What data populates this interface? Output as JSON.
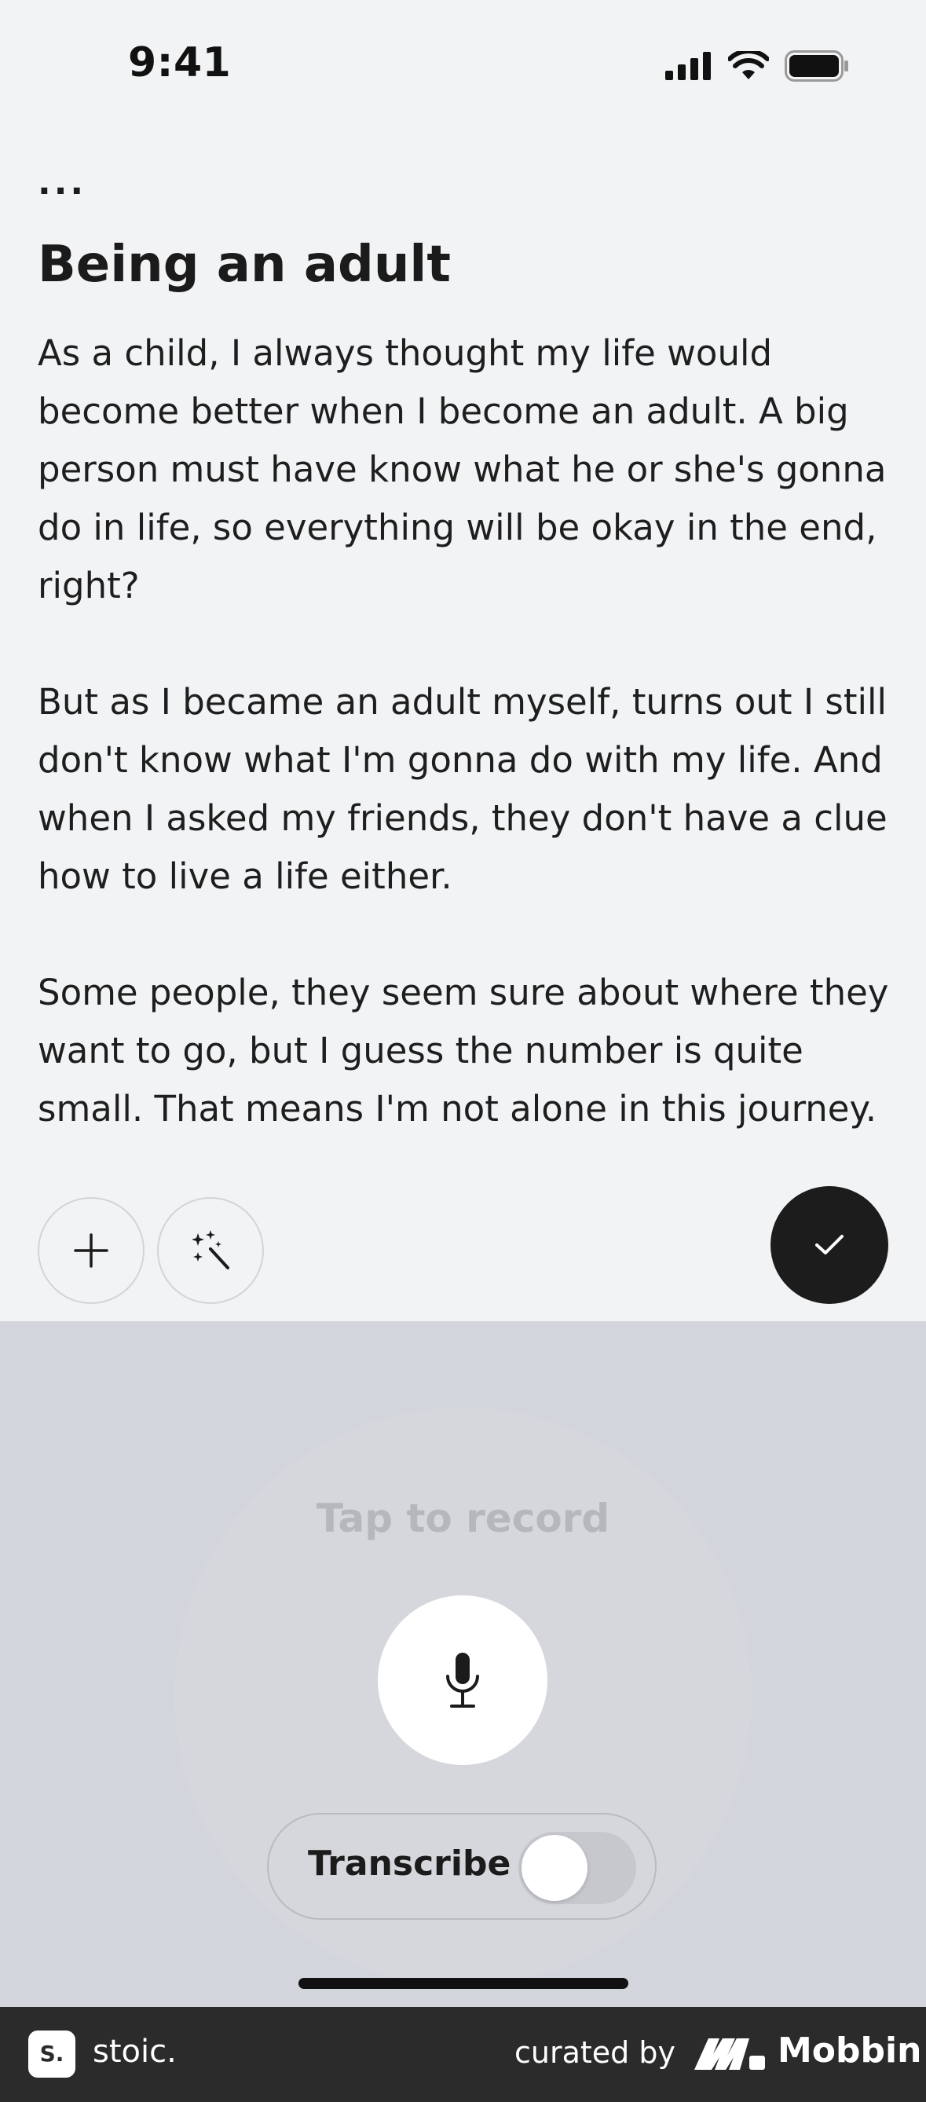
{
  "status_bar": {
    "time": "9:41"
  },
  "note": {
    "more_label": "...",
    "title": "Being an adult",
    "paragraphs": [
      "As a child, I always thought my life would become better when I become an adult. A big person must have know what he or she's gonna do in life, so everything will be okay in the end, right?",
      "But as I became an adult myself, turns out I still don't know what I'm gonna do with my life. And when I asked my friends, they don't have a clue how to live a life either.",
      "Some people, they seem sure about where they want to go, but I guess the number is quite small. That means I'm not alone in this journey."
    ]
  },
  "toolbar": {
    "add_icon": "plus-icon",
    "magic_icon": "magic-wand-icon",
    "done_icon": "checkmark-icon"
  },
  "recorder": {
    "prompt": "Tap to record",
    "mic_icon": "microphone-icon",
    "transcribe_label": "Transcribe",
    "transcribe_on": false
  },
  "footer": {
    "logo_text": "S.",
    "app_name": "stoic.",
    "curated_by": "curated by",
    "brand": "Mobbin"
  },
  "colors": {
    "background": "#f2f3f5",
    "panel": "#d3d5dc",
    "done_button": "#1c1c1c",
    "footer": "#2b2b2b"
  }
}
